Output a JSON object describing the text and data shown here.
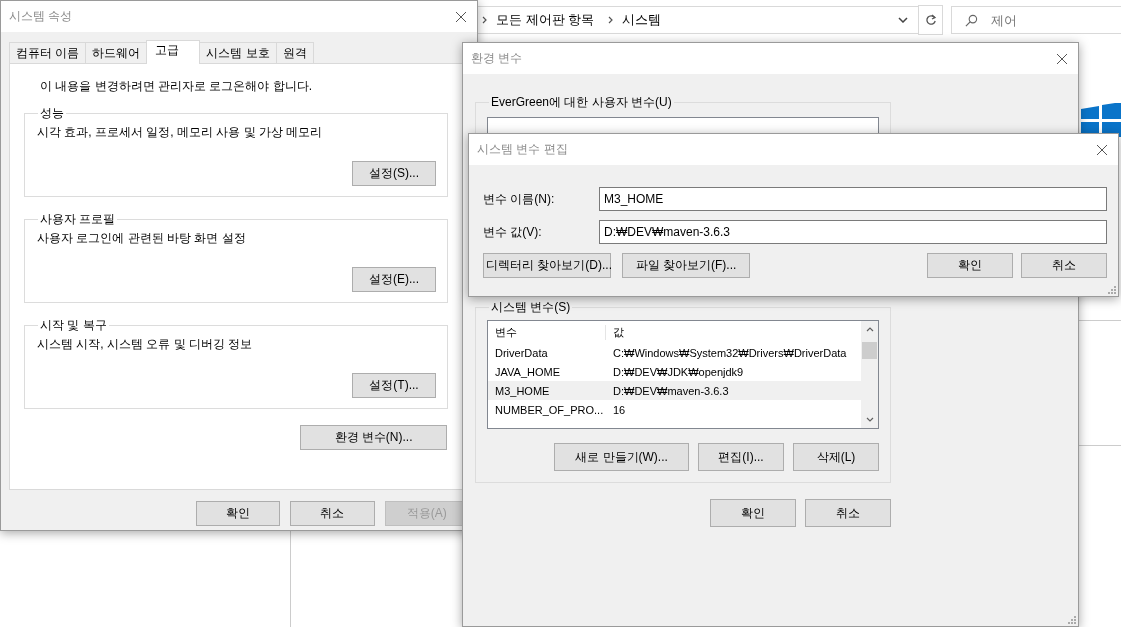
{
  "explorer": {
    "breadcrumb": [
      "모든 제어판 항목",
      "시스템"
    ],
    "search": {
      "placeholder": "제어"
    }
  },
  "system_properties": {
    "title": "시스템 속성",
    "tabs": [
      {
        "label": "컴퓨터 이름",
        "selected": false
      },
      {
        "label": "하드웨어",
        "selected": false
      },
      {
        "label": "고급",
        "selected": true
      },
      {
        "label": "시스템 보호",
        "selected": false
      },
      {
        "label": "원격",
        "selected": false
      }
    ],
    "notice": "이 내용을 변경하려면 관리자로 로그온해야 합니다.",
    "groups": [
      {
        "label": "성능",
        "description": "시각 효과, 프로세서 일정, 메모리 사용 및 가상 메모리",
        "button": "설정(S)..."
      },
      {
        "label": "사용자 프로필",
        "description": "사용자 로그인에 관련된 바탕 화면 설정",
        "button": "설정(E)..."
      },
      {
        "label": "시작 및 복구",
        "description": "시스템 시작, 시스템 오류 및 디버깅 정보",
        "button": "설정(T)..."
      }
    ],
    "env_button": "환경 변수(N)...",
    "buttons": [
      {
        "label": "확인",
        "disabled": false
      },
      {
        "label": "취소",
        "disabled": false
      },
      {
        "label": "적용(A)",
        "disabled": true
      }
    ]
  },
  "environment_variables": {
    "title": "환경 변수",
    "user_group": "EverGreen에 대한 사용자 변수(U)",
    "system_group": "시스템 변수(S)",
    "system_list": {
      "columns": [
        "변수",
        "값"
      ],
      "rows": [
        {
          "name": "DriverData",
          "value": "C:₩Windows₩System32₩Drivers₩DriverData",
          "selected": false
        },
        {
          "name": "JAVA_HOME",
          "value": "D:₩DEV₩JDK₩openjdk9",
          "selected": false
        },
        {
          "name": "M3_HOME",
          "value": "D:₩DEV₩maven-3.6.3",
          "selected": true
        },
        {
          "name": "NUMBER_OF_PRO...",
          "value": "16",
          "selected": false
        }
      ]
    },
    "list_buttons": [
      "새로 만들기(W)...",
      "편집(I)...",
      "삭제(L)"
    ],
    "buttons": [
      "확인",
      "취소"
    ]
  },
  "edit_dialog": {
    "title": "시스템 변수 편집",
    "fields": [
      {
        "label": "변수 이름(N):",
        "value": "M3_HOME"
      },
      {
        "label": "변수 값(V):",
        "value": "D:₩DEV₩maven-3.6.3"
      }
    ],
    "browse_buttons": [
      "디렉터리 찾아보기(D)...",
      "파일 찾아보기(F)..."
    ],
    "buttons": [
      "확인",
      "취소"
    ]
  }
}
